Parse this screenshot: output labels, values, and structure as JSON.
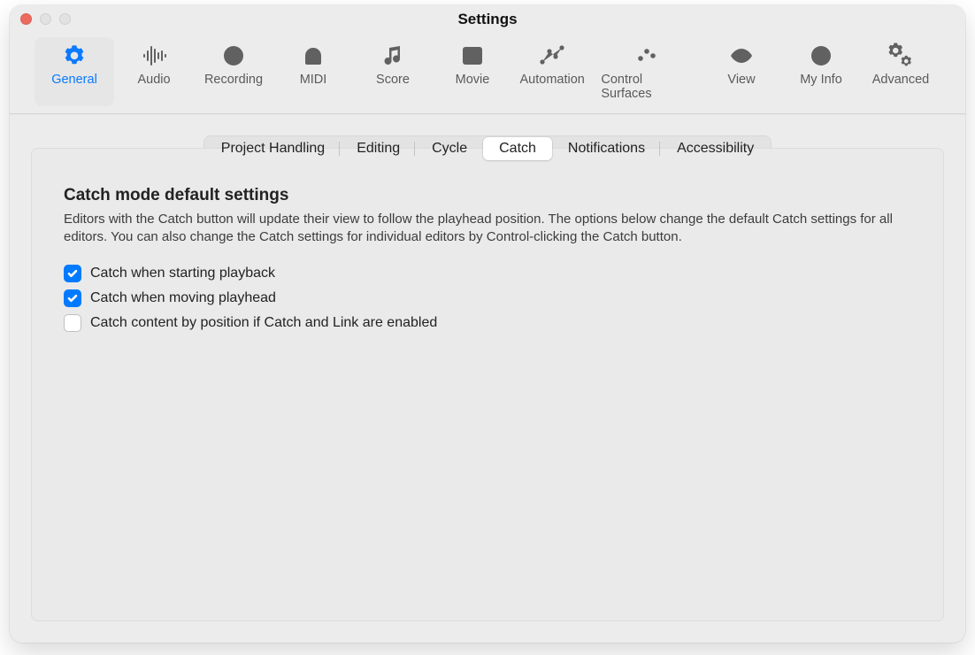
{
  "window": {
    "title": "Settings"
  },
  "toolbar": [
    {
      "id": "general",
      "label": "General",
      "icon": "gear-icon",
      "active": true
    },
    {
      "id": "audio",
      "label": "Audio",
      "icon": "waveform-icon",
      "active": false
    },
    {
      "id": "recording",
      "label": "Recording",
      "icon": "record-icon",
      "active": false
    },
    {
      "id": "midi",
      "label": "MIDI",
      "icon": "midi-icon",
      "active": false
    },
    {
      "id": "score",
      "label": "Score",
      "icon": "notes-icon",
      "active": false
    },
    {
      "id": "movie",
      "label": "Movie",
      "icon": "film-icon",
      "active": false
    },
    {
      "id": "automation",
      "label": "Automation",
      "icon": "automation-icon",
      "active": false
    },
    {
      "id": "control-surfaces",
      "label": "Control Surfaces",
      "icon": "sliders-icon",
      "active": false
    },
    {
      "id": "view",
      "label": "View",
      "icon": "eye-icon",
      "active": false
    },
    {
      "id": "my-info",
      "label": "My Info",
      "icon": "person-icon",
      "active": false
    },
    {
      "id": "advanced",
      "label": "Advanced",
      "icon": "gears-icon",
      "active": false
    }
  ],
  "subtabs": [
    {
      "id": "project-handling",
      "label": "Project Handling",
      "active": false
    },
    {
      "id": "editing",
      "label": "Editing",
      "active": false
    },
    {
      "id": "cycle",
      "label": "Cycle",
      "active": false
    },
    {
      "id": "catch",
      "label": "Catch",
      "active": true
    },
    {
      "id": "notifications",
      "label": "Notifications",
      "active": false
    },
    {
      "id": "accessibility",
      "label": "Accessibility",
      "active": false
    }
  ],
  "section": {
    "title": "Catch mode default settings",
    "description": "Editors with the Catch button will update their view to follow the playhead position. The options below change the default Catch settings for all editors. You can also change the Catch settings for individual editors by Control-clicking the Catch button."
  },
  "checkboxes": [
    {
      "id": "catch-start-playback",
      "label": "Catch when starting playback",
      "checked": true
    },
    {
      "id": "catch-moving-playhead",
      "label": "Catch when moving playhead",
      "checked": true
    },
    {
      "id": "catch-content-by-pos",
      "label": "Catch content by position if Catch and Link are enabled",
      "checked": false
    }
  ]
}
